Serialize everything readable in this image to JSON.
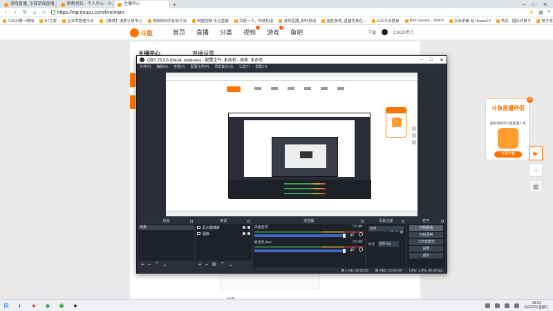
{
  "browser": {
    "tabs": [
      {
        "label": "游戏直播_全部游戏直播_"
      },
      {
        "label": "刷新排位 - 个人中心 - 斗..."
      },
      {
        "label": "主播中心"
      }
    ],
    "address": "https://mp.douyu.com/live/main",
    "bookmarks": [
      "CSGO第一眼线",
      "BT之家",
      "企业零管理平台",
      "【聚焦】搜索订单中心",
      "地肤的网页比较平台",
      "网盛视频 乐旦盖播",
      "百度一下，你就知道",
      "游戏直播_即时频道",
      "金胜游戏_直播免费在...",
      "公众平台登录",
      "Riot Games - Twitch",
      "天际争霸 战 Hoaaa72",
      "首页 - 国际开放平",
      "电子竞技 LOL Dot..."
    ]
  },
  "site": {
    "logo": "斗鱼",
    "nav": [
      "首页",
      "直播",
      "分类",
      "视频",
      "游戏",
      "鱼吧"
    ],
    "right": {
      "download": "下载",
      "user": "CSGO老刀"
    }
  },
  "page": {
    "sidebar_title": "主播中心",
    "title": "直播设置",
    "footer": "帧度"
  },
  "obs": {
    "title": "OBS 25.0.8 (64-bit, windows) - 配置文件: 未命名 - 场景: 未命名",
    "menu": [
      "文件(F)",
      "编辑(E)",
      "查看(V)",
      "配置文件(P)",
      "场景集合(S)",
      "工具(T)",
      "帮助(H)"
    ],
    "docks": {
      "scenes": {
        "title": "场景",
        "items": [
          "场景"
        ]
      },
      "sources": {
        "title": "来源",
        "items": [
          "显示器捕获",
          "图像"
        ]
      },
      "mixer": {
        "title": "混音器",
        "channels": [
          {
            "name": "桌面音频",
            "db": "0.0 dB"
          },
          {
            "name": "麦克风/Aux",
            "db": "0.0 dB"
          }
        ]
      },
      "transitions": {
        "title": "场景过渡",
        "type": "淡出",
        "duration_label": "时长",
        "duration": "300 ms"
      },
      "controls": {
        "title": "控件",
        "buttons": [
          "开始推流",
          "开始录制",
          "工作室模式",
          "设置",
          "退出"
        ]
      }
    },
    "status": {
      "live": "LIVE: 00:00:00",
      "rec": "REC: 00:00:00",
      "cpu": "CPU: 1.9%, 60.00 fps"
    }
  },
  "ad": {
    "title": "斗鱼直播伴侣",
    "subtitle": "超好用的PC端直播工具",
    "button": "立即下载"
  },
  "taskbar": {
    "time": "20:24",
    "date": "2022/2/9 星期三"
  },
  "colors": {
    "brand": "#ff7300",
    "obs_bg": "#2b2e38",
    "obs_dock": "#1f2129"
  }
}
